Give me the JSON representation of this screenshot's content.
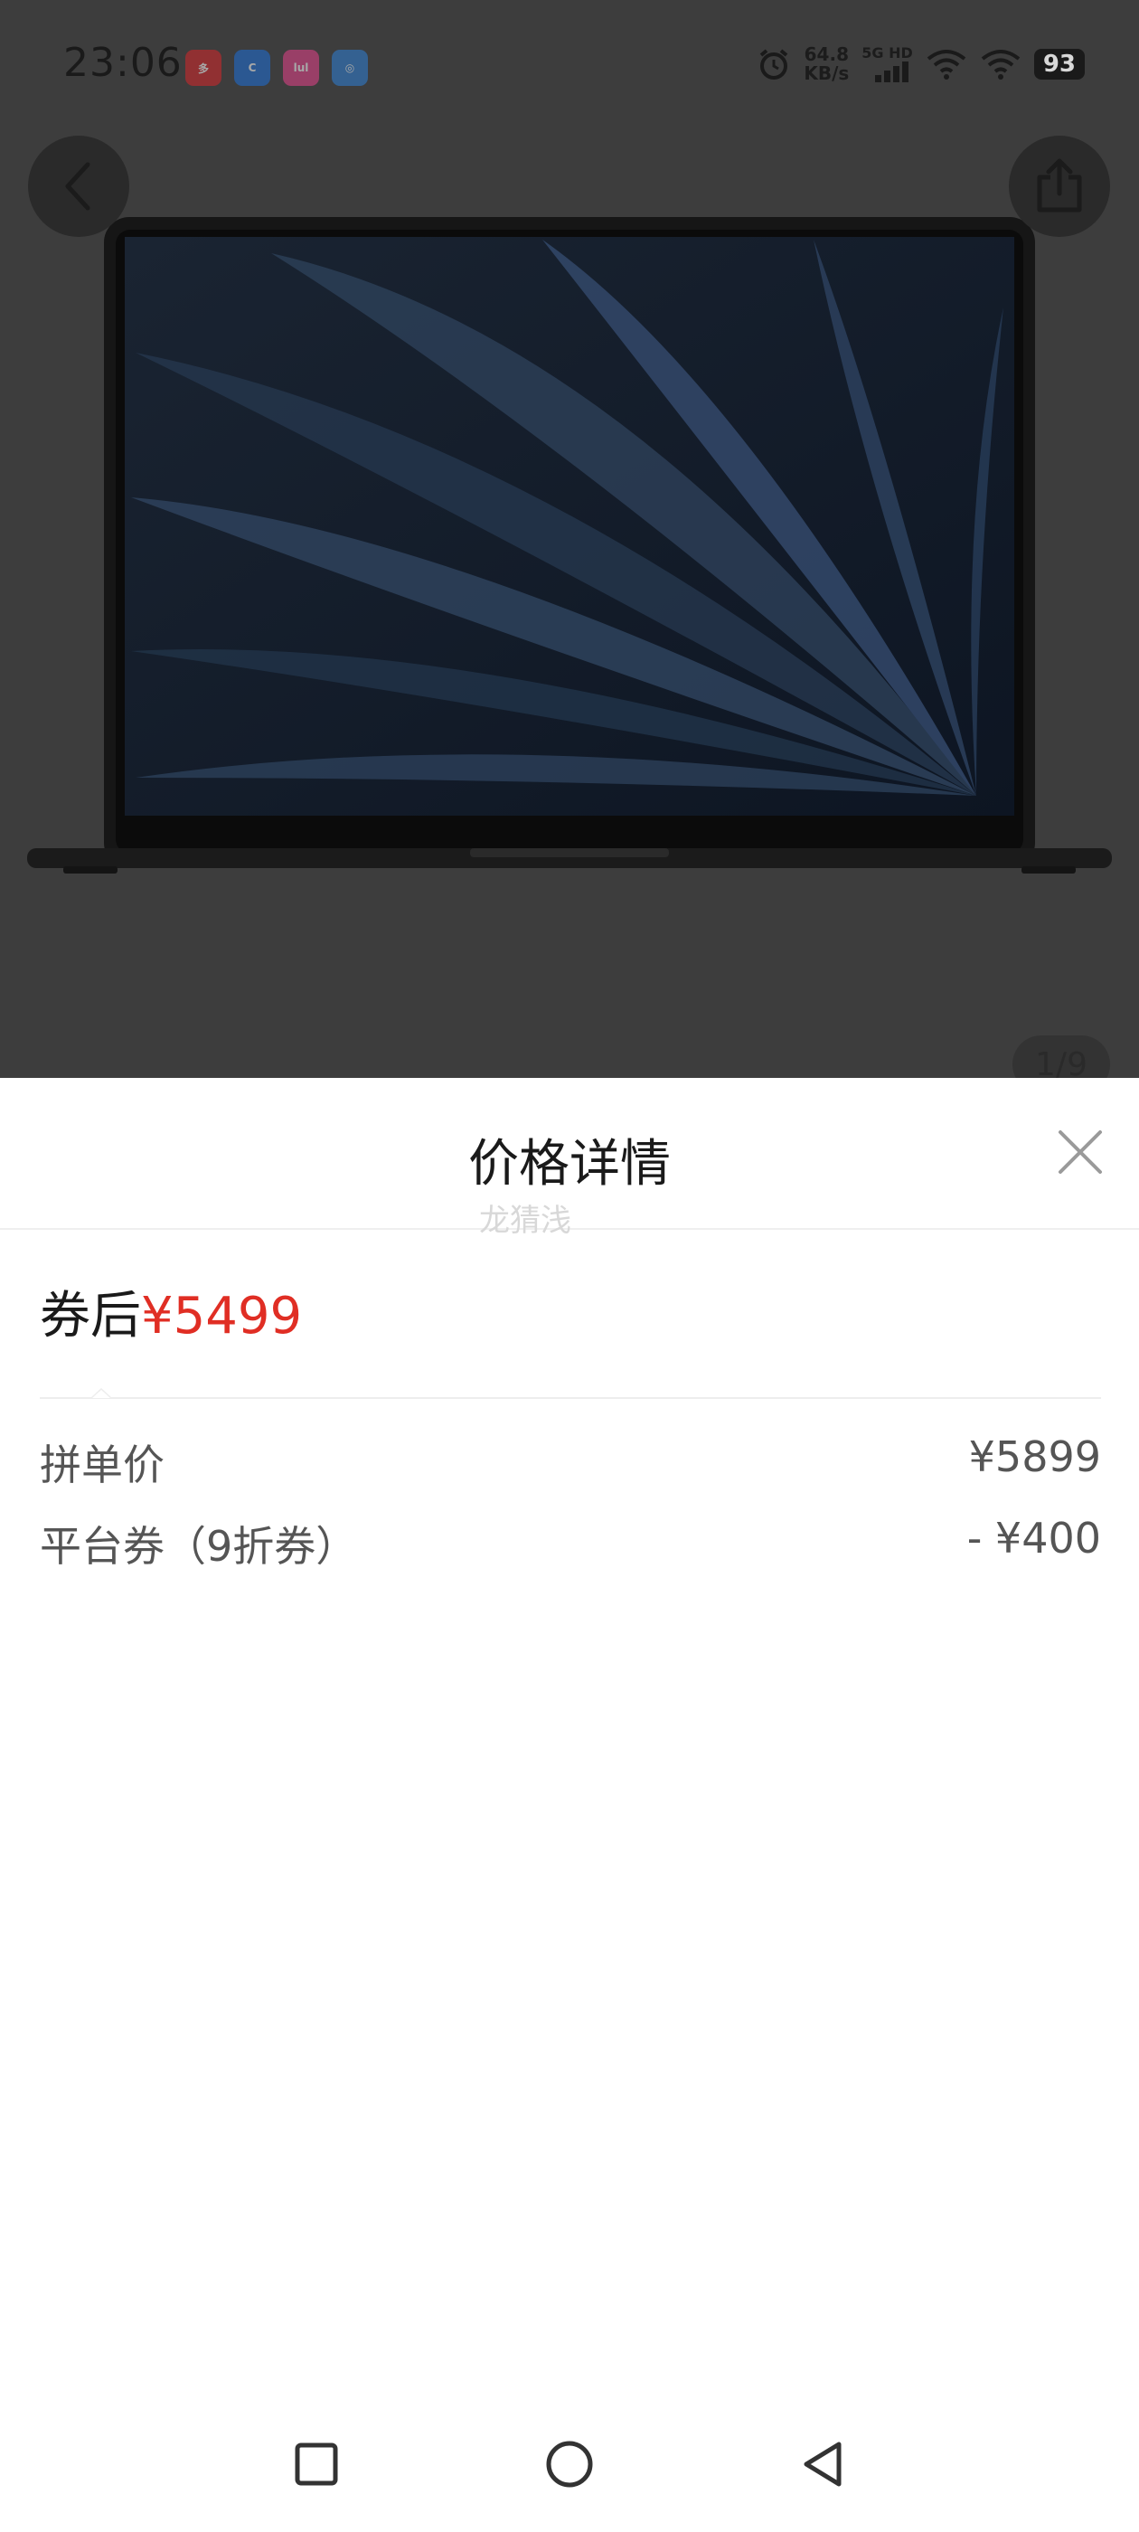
{
  "status_bar": {
    "time": "23:06",
    "app_icons": [
      {
        "name": "app-icon-1",
        "color": "#d6262a",
        "glyph": "多"
      },
      {
        "name": "app-icon-2",
        "color": "#1d6fd8",
        "glyph": "C"
      },
      {
        "name": "app-icon-3",
        "color": "#e5418a",
        "glyph": "lul"
      },
      {
        "name": "app-icon-4",
        "color": "#2d7fd6",
        "glyph": "◎"
      }
    ],
    "net_speed_value": "64.8",
    "net_speed_unit": "KB/s",
    "signal_label": "5G HD",
    "battery": "93"
  },
  "product": {
    "page_indicator": "1/9"
  },
  "sheet": {
    "title": "价格详情",
    "watermark": "龙猜浅",
    "after_coupon_label": "券后",
    "after_coupon_price": "¥5499",
    "rows": [
      {
        "label": "拼单价",
        "value": "¥5899"
      },
      {
        "label": "平台券（9折券）",
        "value": "- ¥400"
      }
    ]
  },
  "colors": {
    "accent_red": "#e02e24",
    "overlay": "#3d3d3d"
  }
}
